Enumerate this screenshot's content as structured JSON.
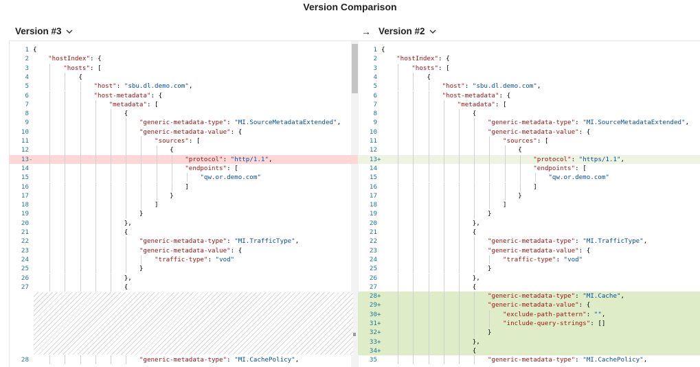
{
  "title": "Version Comparison",
  "left_version": {
    "label": "Version #3",
    "chevron": "chevron-down-icon"
  },
  "right_version": {
    "label": "Version #2",
    "chevron": "chevron-down-icon"
  },
  "arrow": "→",
  "left_lines": [
    {
      "n": "1",
      "m": "",
      "t": [
        [
          "p",
          "{"
        ]
      ]
    },
    {
      "n": "2",
      "m": "",
      "t": [
        [
          "w",
          "    "
        ],
        [
          "k",
          "\"hostIndex\""
        ],
        [
          "p",
          ": {"
        ]
      ]
    },
    {
      "n": "3",
      "m": "",
      "t": [
        [
          "w",
          "        "
        ],
        [
          "k",
          "\"hosts\""
        ],
        [
          "p",
          ": ["
        ]
      ]
    },
    {
      "n": "4",
      "m": "",
      "t": [
        [
          "w",
          "            "
        ],
        [
          "p",
          "{"
        ]
      ]
    },
    {
      "n": "5",
      "m": "",
      "t": [
        [
          "w",
          "                "
        ],
        [
          "k",
          "\"host\""
        ],
        [
          "p",
          ": "
        ],
        [
          "s",
          "\"sbu.dl.demo.com\""
        ],
        [
          "p",
          ","
        ]
      ]
    },
    {
      "n": "6",
      "m": "",
      "t": [
        [
          "w",
          "                "
        ],
        [
          "k",
          "\"host-metadata\""
        ],
        [
          "p",
          ": {"
        ]
      ]
    },
    {
      "n": "7",
      "m": "",
      "t": [
        [
          "w",
          "                    "
        ],
        [
          "k",
          "\"metadata\""
        ],
        [
          "p",
          ": ["
        ]
      ]
    },
    {
      "n": "8",
      "m": "",
      "t": [
        [
          "w",
          "                        "
        ],
        [
          "p",
          "{"
        ]
      ]
    },
    {
      "n": "9",
      "m": "",
      "t": [
        [
          "w",
          "                            "
        ],
        [
          "k",
          "\"generic-metadata-type\""
        ],
        [
          "p",
          ": "
        ],
        [
          "s",
          "\"MI.SourceMetadataExtended\""
        ],
        [
          "p",
          ","
        ]
      ]
    },
    {
      "n": "10",
      "m": "",
      "t": [
        [
          "w",
          "                            "
        ],
        [
          "k",
          "\"generic-metadata-value\""
        ],
        [
          "p",
          ": {"
        ]
      ]
    },
    {
      "n": "11",
      "m": "",
      "t": [
        [
          "w",
          "                                "
        ],
        [
          "k",
          "\"sources\""
        ],
        [
          "p",
          ": ["
        ]
      ]
    },
    {
      "n": "12",
      "m": "",
      "t": [
        [
          "w",
          "                                    "
        ],
        [
          "p",
          "{"
        ]
      ]
    },
    {
      "n": "13",
      "m": "-",
      "t": [
        [
          "w",
          "                                        "
        ],
        [
          "k",
          "\"protocol\""
        ],
        [
          "p",
          ": "
        ],
        [
          "s",
          "\"http/1.1\""
        ],
        [
          "p",
          ","
        ]
      ],
      "cls": "del"
    },
    {
      "n": "14",
      "m": "",
      "t": [
        [
          "w",
          "                                        "
        ],
        [
          "k",
          "\"endpoints\""
        ],
        [
          "p",
          ": ["
        ]
      ]
    },
    {
      "n": "15",
      "m": "",
      "t": [
        [
          "w",
          "                                            "
        ],
        [
          "s",
          "\"qw.or.demo.com\""
        ]
      ]
    },
    {
      "n": "16",
      "m": "",
      "t": [
        [
          "w",
          "                                        "
        ],
        [
          "p",
          "]"
        ]
      ]
    },
    {
      "n": "17",
      "m": "",
      "t": [
        [
          "w",
          "                                    "
        ],
        [
          "p",
          "}"
        ]
      ]
    },
    {
      "n": "18",
      "m": "",
      "t": [
        [
          "w",
          "                                "
        ],
        [
          "p",
          "]"
        ]
      ]
    },
    {
      "n": "19",
      "m": "",
      "t": [
        [
          "w",
          "                            "
        ],
        [
          "p",
          "}"
        ]
      ]
    },
    {
      "n": "20",
      "m": "",
      "t": [
        [
          "w",
          "                        "
        ],
        [
          "p",
          "},"
        ]
      ]
    },
    {
      "n": "21",
      "m": "",
      "t": [
        [
          "w",
          "                        "
        ],
        [
          "p",
          "{"
        ]
      ]
    },
    {
      "n": "22",
      "m": "",
      "t": [
        [
          "w",
          "                            "
        ],
        [
          "k",
          "\"generic-metadata-type\""
        ],
        [
          "p",
          ": "
        ],
        [
          "s",
          "\"MI.TrafficType\""
        ],
        [
          "p",
          ","
        ]
      ]
    },
    {
      "n": "23",
      "m": "",
      "t": [
        [
          "w",
          "                            "
        ],
        [
          "k",
          "\"generic-metadata-value\""
        ],
        [
          "p",
          ": {"
        ]
      ]
    },
    {
      "n": "24",
      "m": "",
      "t": [
        [
          "w",
          "                                "
        ],
        [
          "k",
          "\"traffic-type\""
        ],
        [
          "p",
          ": "
        ],
        [
          "s",
          "\"vod\""
        ]
      ]
    },
    {
      "n": "25",
      "m": "",
      "t": [
        [
          "w",
          "                            "
        ],
        [
          "p",
          "}"
        ]
      ]
    },
    {
      "n": "26",
      "m": "",
      "t": [
        [
          "w",
          "                        "
        ],
        [
          "p",
          "},"
        ]
      ]
    },
    {
      "n": "27",
      "m": "",
      "t": [
        [
          "w",
          "                        "
        ],
        [
          "p",
          "{"
        ]
      ]
    },
    {
      "n": "",
      "m": "",
      "t": [],
      "gap": true
    },
    {
      "n": "28",
      "m": "",
      "t": [
        [
          "w",
          "                            "
        ],
        [
          "k",
          "\"generic-metadata-type\""
        ],
        [
          "p",
          ": "
        ],
        [
          "s",
          "\"MI.CachePolicy\""
        ],
        [
          "p",
          ","
        ]
      ]
    }
  ],
  "right_lines": [
    {
      "n": "1",
      "m": "",
      "t": [
        [
          "p",
          "{"
        ]
      ]
    },
    {
      "n": "2",
      "m": "",
      "t": [
        [
          "w",
          "    "
        ],
        [
          "k",
          "\"hostIndex\""
        ],
        [
          "p",
          ": {"
        ]
      ]
    },
    {
      "n": "3",
      "m": "",
      "t": [
        [
          "w",
          "        "
        ],
        [
          "k",
          "\"hosts\""
        ],
        [
          "p",
          ": ["
        ]
      ]
    },
    {
      "n": "4",
      "m": "",
      "t": [
        [
          "w",
          "            "
        ],
        [
          "p",
          "{"
        ]
      ]
    },
    {
      "n": "5",
      "m": "",
      "t": [
        [
          "w",
          "                "
        ],
        [
          "k",
          "\"host\""
        ],
        [
          "p",
          ": "
        ],
        [
          "s",
          "\"sbu.dl.demo.com\""
        ],
        [
          "p",
          ","
        ]
      ]
    },
    {
      "n": "6",
      "m": "",
      "t": [
        [
          "w",
          "                "
        ],
        [
          "k",
          "\"host-metadata\""
        ],
        [
          "p",
          ": {"
        ]
      ]
    },
    {
      "n": "7",
      "m": "",
      "t": [
        [
          "w",
          "                    "
        ],
        [
          "k",
          "\"metadata\""
        ],
        [
          "p",
          ": ["
        ]
      ]
    },
    {
      "n": "8",
      "m": "",
      "t": [
        [
          "w",
          "                        "
        ],
        [
          "p",
          "{"
        ]
      ]
    },
    {
      "n": "9",
      "m": "",
      "t": [
        [
          "w",
          "                            "
        ],
        [
          "k",
          "\"generic-metadata-type\""
        ],
        [
          "p",
          ": "
        ],
        [
          "s",
          "\"MI.SourceMetadataExtended\""
        ],
        [
          "p",
          ","
        ]
      ]
    },
    {
      "n": "10",
      "m": "",
      "t": [
        [
          "w",
          "                            "
        ],
        [
          "k",
          "\"generic-metadata-value\""
        ],
        [
          "p",
          ": {"
        ]
      ]
    },
    {
      "n": "11",
      "m": "",
      "t": [
        [
          "w",
          "                                "
        ],
        [
          "k",
          "\"sources\""
        ],
        [
          "p",
          ": ["
        ]
      ]
    },
    {
      "n": "12",
      "m": "",
      "t": [
        [
          "w",
          "                                    "
        ],
        [
          "p",
          "{"
        ]
      ]
    },
    {
      "n": "13",
      "m": "+",
      "t": [
        [
          "w",
          "                                        "
        ],
        [
          "k",
          "\"protocol\""
        ],
        [
          "p",
          ": "
        ],
        [
          "s",
          "\"https/1.1\""
        ],
        [
          "p",
          ","
        ]
      ],
      "cls": "ins2"
    },
    {
      "n": "14",
      "m": "",
      "t": [
        [
          "w",
          "                                        "
        ],
        [
          "k",
          "\"endpoints\""
        ],
        [
          "p",
          ": ["
        ]
      ]
    },
    {
      "n": "15",
      "m": "",
      "t": [
        [
          "w",
          "                                            "
        ],
        [
          "s",
          "\"qw.or.demo.com\""
        ]
      ]
    },
    {
      "n": "16",
      "m": "",
      "t": [
        [
          "w",
          "                                        "
        ],
        [
          "p",
          "]"
        ]
      ]
    },
    {
      "n": "17",
      "m": "",
      "t": [
        [
          "w",
          "                                    "
        ],
        [
          "p",
          "}"
        ]
      ]
    },
    {
      "n": "18",
      "m": "",
      "t": [
        [
          "w",
          "                                "
        ],
        [
          "p",
          "]"
        ]
      ]
    },
    {
      "n": "19",
      "m": "",
      "t": [
        [
          "w",
          "                            "
        ],
        [
          "p",
          "}"
        ]
      ]
    },
    {
      "n": "20",
      "m": "",
      "t": [
        [
          "w",
          "                        "
        ],
        [
          "p",
          "},"
        ]
      ]
    },
    {
      "n": "21",
      "m": "",
      "t": [
        [
          "w",
          "                        "
        ],
        [
          "p",
          "{"
        ]
      ]
    },
    {
      "n": "22",
      "m": "",
      "t": [
        [
          "w",
          "                            "
        ],
        [
          "k",
          "\"generic-metadata-type\""
        ],
        [
          "p",
          ": "
        ],
        [
          "s",
          "\"MI.TrafficType\""
        ],
        [
          "p",
          ","
        ]
      ]
    },
    {
      "n": "23",
      "m": "",
      "t": [
        [
          "w",
          "                            "
        ],
        [
          "k",
          "\"generic-metadata-value\""
        ],
        [
          "p",
          ": {"
        ]
      ]
    },
    {
      "n": "24",
      "m": "",
      "t": [
        [
          "w",
          "                                "
        ],
        [
          "k",
          "\"traffic-type\""
        ],
        [
          "p",
          ": "
        ],
        [
          "s",
          "\"vod\""
        ]
      ]
    },
    {
      "n": "25",
      "m": "",
      "t": [
        [
          "w",
          "                            "
        ],
        [
          "p",
          "}"
        ]
      ]
    },
    {
      "n": "26",
      "m": "",
      "t": [
        [
          "w",
          "                        "
        ],
        [
          "p",
          "},"
        ]
      ]
    },
    {
      "n": "27",
      "m": "",
      "t": [
        [
          "w",
          "                        "
        ],
        [
          "p",
          "{"
        ]
      ]
    },
    {
      "n": "28",
      "m": "+",
      "t": [
        [
          "w",
          "                            "
        ],
        [
          "k",
          "\"generic-metadata-type\""
        ],
        [
          "p",
          ": "
        ],
        [
          "s",
          "\"MI.Cache\""
        ],
        [
          "p",
          ","
        ]
      ],
      "cls": "ins"
    },
    {
      "n": "29",
      "m": "+",
      "t": [
        [
          "w",
          "                            "
        ],
        [
          "k",
          "\"generic-metadata-value\""
        ],
        [
          "p",
          ": {"
        ]
      ],
      "cls": "ins"
    },
    {
      "n": "30",
      "m": "+",
      "t": [
        [
          "w",
          "                                "
        ],
        [
          "k",
          "\"exclude-path-pattern\""
        ],
        [
          "p",
          ": "
        ],
        [
          "s",
          "\"\""
        ],
        [
          "p",
          ","
        ]
      ],
      "cls": "ins"
    },
    {
      "n": "31",
      "m": "+",
      "t": [
        [
          "w",
          "                                "
        ],
        [
          "k",
          "\"include-query-strings\""
        ],
        [
          "p",
          ": []"
        ]
      ],
      "cls": "ins"
    },
    {
      "n": "32",
      "m": "+",
      "t": [
        [
          "w",
          "                            "
        ],
        [
          "p",
          "}"
        ]
      ],
      "cls": "ins"
    },
    {
      "n": "33",
      "m": "+",
      "t": [
        [
          "w",
          "                        "
        ],
        [
          "p",
          "},"
        ]
      ],
      "cls": "ins"
    },
    {
      "n": "34",
      "m": "+",
      "t": [
        [
          "w",
          "                        "
        ],
        [
          "p",
          "{"
        ]
      ],
      "cls": "ins"
    },
    {
      "n": "35",
      "m": "",
      "t": [
        [
          "w",
          "                            "
        ],
        [
          "k",
          "\"generic-metadata-type\""
        ],
        [
          "p",
          ": "
        ],
        [
          "s",
          "\"MI.CachePolicy\""
        ],
        [
          "p",
          ","
        ]
      ]
    }
  ]
}
